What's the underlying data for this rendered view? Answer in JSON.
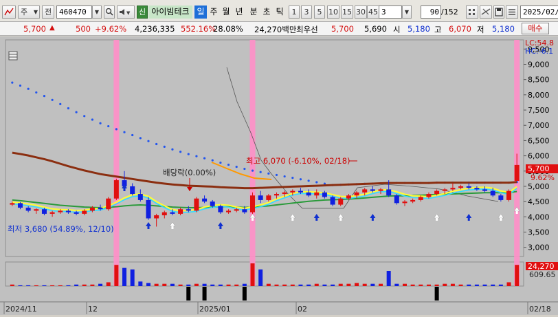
{
  "toolbar": {
    "mode1": "주",
    "mode2": "전",
    "code": "460470",
    "stock_name": "아이빔테크",
    "period_day": "일",
    "period_week": "주",
    "period_month": "월",
    "period_year": "년",
    "period_min": "분",
    "period_sec": "초",
    "period_tick": "틱",
    "intervals": [
      "1",
      "3",
      "5",
      "10",
      "15",
      "30",
      "45",
      "60"
    ],
    "custom_interval": "3",
    "count_value": "90",
    "count_total": "/152",
    "date": "2025/02/"
  },
  "quote": {
    "price": "5,700",
    "change": "500",
    "change_pct": "+9.62%",
    "volume": "4,236,335",
    "vol_ratio": "552.16%",
    "turnover": "28.08%",
    "amount": "24,270백만",
    "label_pref": "최우선",
    "ask": "5,700",
    "bid": "5,690",
    "open_label": "시",
    "open": "5,180",
    "high_label": "고",
    "high": "6,070",
    "low_label": "저",
    "low": "5,180",
    "order_button": "매수"
  },
  "annotations": {
    "high": "최고 6,070 (-6.10%, 02/18)",
    "low": "최저 3,680 (54.89%, 12/10)",
    "dividend": "배당락(0.00%)",
    "lc": "LC:54.8",
    "hc": "HC:-6.1",
    "price_badge": "5,700",
    "pct_badge": "9.62%",
    "vol_badge": "24,270",
    "vol_ma_badge": "609.65"
  },
  "chart_data": {
    "type": "candlestick",
    "ylim": [
      2600,
      6600
    ],
    "y_ticks": [
      "9,500",
      "9,000",
      "8,500",
      "8,000",
      "7,500",
      "7,000",
      "6,500",
      "6,000",
      "5,500",
      "5,000",
      "4,500",
      "4,000",
      "3,500",
      "3,000"
    ],
    "x_labels": [
      "2024/11",
      "12",
      "2025/01",
      "02",
      "02/18"
    ],
    "candles": [
      [
        4400,
        4500,
        4350,
        4450
      ],
      [
        4450,
        4480,
        4250,
        4300
      ],
      [
        4300,
        4350,
        4150,
        4200
      ],
      [
        4200,
        4280,
        4100,
        4250
      ],
      [
        4250,
        4300,
        4050,
        4100
      ],
      [
        4100,
        4200,
        4000,
        4150
      ],
      [
        4150,
        4250,
        4100,
        4200
      ],
      [
        4200,
        4250,
        4100,
        4150
      ],
      [
        4150,
        4200,
        4050,
        4100
      ],
      [
        4100,
        4250,
        4050,
        4200
      ],
      [
        4200,
        4350,
        4150,
        4300
      ],
      [
        4300,
        4400,
        4200,
        4250
      ],
      [
        4250,
        4650,
        4200,
        4600
      ],
      [
        4600,
        5250,
        4550,
        5200
      ],
      [
        5200,
        5500,
        4900,
        5000
      ],
      [
        5000,
        5100,
        4700,
        4750
      ],
      [
        4750,
        4900,
        4500,
        4550
      ],
      [
        4550,
        4650,
        3900,
        3950
      ],
      [
        3950,
        4100,
        3680,
        4050
      ],
      [
        4050,
        4200,
        3950,
        4150
      ],
      [
        4150,
        4250,
        4050,
        4100
      ],
      [
        4100,
        4300,
        4050,
        4250
      ],
      [
        4250,
        4350,
        4150,
        4200
      ],
      [
        4200,
        4650,
        4150,
        4600
      ],
      [
        4600,
        4700,
        4450,
        4500
      ],
      [
        4500,
        4550,
        4300,
        4350
      ],
      [
        4350,
        4400,
        4100,
        4150
      ],
      [
        4150,
        4250,
        4100,
        4200
      ],
      [
        4200,
        4300,
        4150,
        4250
      ],
      [
        4250,
        4350,
        4100,
        4150
      ],
      [
        4150,
        4800,
        4100,
        4700
      ],
      [
        4700,
        4850,
        4450,
        4550
      ],
      [
        4550,
        4750,
        4500,
        4700
      ],
      [
        4700,
        4800,
        4600,
        4750
      ],
      [
        4750,
        4850,
        4650,
        4800
      ],
      [
        4800,
        4900,
        4700,
        4850
      ],
      [
        4850,
        4950,
        4750,
        4800
      ],
      [
        4800,
        4900,
        4650,
        4700
      ],
      [
        4700,
        4900,
        4600,
        4800
      ],
      [
        4800,
        4850,
        4600,
        4650
      ],
      [
        4650,
        4700,
        4350,
        4400
      ],
      [
        4400,
        4650,
        4350,
        4600
      ],
      [
        4600,
        4750,
        4550,
        4700
      ],
      [
        4700,
        4850,
        4600,
        4800
      ],
      [
        4800,
        4950,
        4700,
        4900
      ],
      [
        4900,
        5000,
        4800,
        4850
      ],
      [
        4850,
        4950,
        4750,
        4900
      ],
      [
        4900,
        5200,
        4650,
        4700
      ],
      [
        4700,
        4750,
        4400,
        4450
      ],
      [
        4450,
        4550,
        4350,
        4500
      ],
      [
        4500,
        4600,
        4450,
        4550
      ],
      [
        4550,
        4700,
        4500,
        4650
      ],
      [
        4650,
        4800,
        4600,
        4750
      ],
      [
        4750,
        4900,
        4700,
        4850
      ],
      [
        4850,
        4950,
        4750,
        4900
      ],
      [
        4900,
        5100,
        4850,
        4950
      ],
      [
        4950,
        5050,
        4900,
        5000
      ],
      [
        5000,
        5100,
        4900,
        4950
      ],
      [
        4950,
        5000,
        4850,
        4900
      ],
      [
        4900,
        5000,
        4800,
        4850
      ],
      [
        4850,
        4950,
        4650,
        4700
      ],
      [
        4700,
        4750,
        4500,
        4550
      ],
      [
        4550,
        4900,
        4500,
        4850
      ],
      [
        5180,
        6070,
        5180,
        5700
      ]
    ],
    "ma5": [
      4420,
      4400,
      4360,
      4320,
      4260,
      4200,
      4180,
      4170,
      4150,
      4160,
      4200,
      4220,
      4300,
      4420,
      4560,
      4660,
      4690,
      4610,
      4440,
      4300,
      4180,
      4140,
      4150,
      4180,
      4260,
      4310,
      4340,
      4320,
      4260,
      4220,
      4270,
      4330,
      4410,
      4530,
      4620,
      4710,
      4760,
      4760,
      4750,
      4730,
      4670,
      4610,
      4600,
      4640,
      4680,
      4760,
      4820,
      4830,
      4760,
      4680,
      4630,
      4620,
      4600,
      4650,
      4700,
      4780,
      4830,
      4880,
      4900,
      4910,
      4880,
      4790,
      4740,
      4930
    ],
    "ma20": [
      4550,
      4530,
      4500,
      4470,
      4440,
      4410,
      4380,
      4360,
      4340,
      4320,
      4310,
      4300,
      4310,
      4330,
      4360,
      4380,
      4390,
      4380,
      4360,
      4340,
      4320,
      4310,
      4300,
      4300,
      4310,
      4320,
      4330,
      4330,
      4320,
      4310,
      4320,
      4340,
      4360,
      4390,
      4420,
      4450,
      4480,
      4510,
      4530,
      4550,
      4560,
      4570,
      4580,
      4600,
      4620,
      4640,
      4660,
      4680,
      4690,
      4690,
      4700,
      4710,
      4720,
      4730,
      4740,
      4750,
      4760,
      4770,
      4780,
      4790,
      4790,
      4790,
      4790,
      4830
    ],
    "ma60": [
      6100,
      6060,
      6010,
      5950,
      5890,
      5820,
      5740,
      5660,
      5590,
      5520,
      5460,
      5400,
      5360,
      5320,
      5280,
      5240,
      5200,
      5160,
      5120,
      5090,
      5060,
      5040,
      5020,
      5010,
      5000,
      4990,
      4970,
      4960,
      4950,
      4940,
      4940,
      4950,
      4960,
      4970,
      4980,
      4990,
      5000,
      5010,
      5020,
      5030,
      5040,
      5050,
      5060,
      5070,
      5080,
      5090,
      5100,
      5110,
      5110,
      5110,
      5110,
      5110,
      5110,
      5120,
      5120,
      5120,
      5120,
      5120,
      5120,
      5120,
      5120,
      5120,
      5120,
      5140
    ],
    "volume": [
      2,
      1,
      1,
      1,
      1,
      1,
      1,
      1,
      2,
      2,
      2,
      3,
      5,
      28,
      24,
      22,
      6,
      4,
      3,
      3,
      3,
      2,
      2,
      3,
      3,
      2,
      2,
      2,
      2,
      3,
      30,
      22,
      3,
      2,
      2,
      2,
      2,
      2,
      3,
      2,
      2,
      3,
      3,
      4,
      3,
      3,
      3,
      20,
      3,
      3,
      2,
      2,
      2,
      2,
      3,
      3,
      2,
      2,
      2,
      2,
      2,
      2,
      5,
      28
    ]
  }
}
